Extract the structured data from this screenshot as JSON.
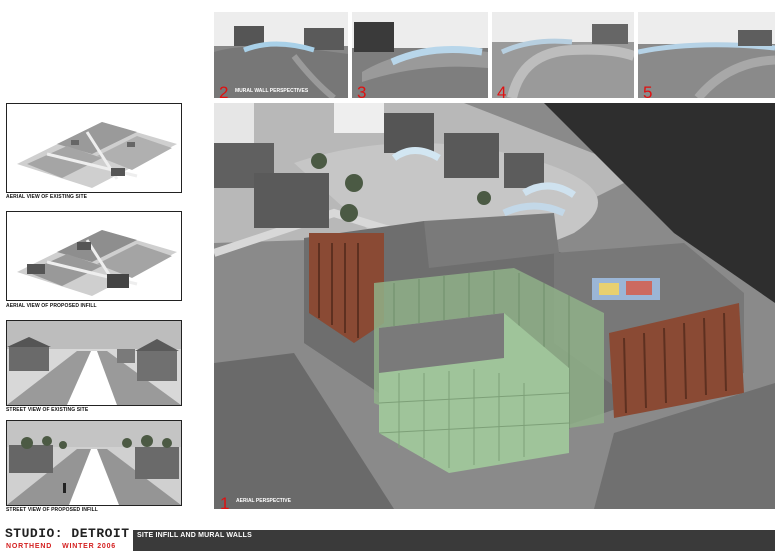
{
  "left_panels": [
    {
      "caption": "AERIAL VIEW OF EXISTING SITE"
    },
    {
      "caption": "AERIAL VIEW OF PROPOSED INFILL"
    },
    {
      "caption": "STREET VIEW OF EXISTING SITE"
    },
    {
      "caption": "STREET VIEW OF PROPOSED INFILL"
    }
  ],
  "top_panels": [
    {
      "number": "2",
      "caption": "MURAL WALL PERSPECTIVES"
    },
    {
      "number": "3",
      "caption": ""
    },
    {
      "number": "4",
      "caption": ""
    },
    {
      "number": "5",
      "caption": ""
    }
  ],
  "main_panel": {
    "number": "1",
    "caption": "AERIAL PERSPECTIVE"
  },
  "footer": {
    "studio": "STUDIO: DETROIT",
    "location": "NORTHEND",
    "term": "WINTER 2006",
    "banner": "SITE INFILL AND MURAL WALLS"
  },
  "colors": {
    "accent": "#e01010",
    "banner": "#3a3a3a",
    "brick": "#8a4a34",
    "glass": "#9fc49a"
  }
}
